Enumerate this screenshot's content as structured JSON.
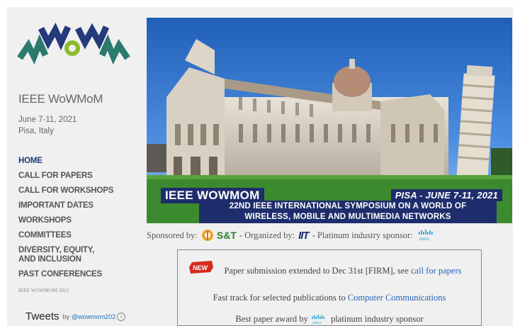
{
  "site": {
    "title": "IEEE WoWMoM",
    "date": "June 7-11, 2021",
    "location": "Pisa, Italy",
    "footer_note": "IEEE WOWMOM 2021"
  },
  "nav": {
    "items": [
      {
        "label": "HOME",
        "active": true
      },
      {
        "label": "CALL FOR PAPERS"
      },
      {
        "label": "CALL FOR WORKSHOPS"
      },
      {
        "label": "IMPORTANT DATES"
      },
      {
        "label": "WORKSHOPS"
      },
      {
        "label": "COMMITTEES"
      },
      {
        "label": "DIVERSITY, EQUITY, AND INCLUSION"
      },
      {
        "label": "PAST CONFERENCES"
      }
    ]
  },
  "tweets": {
    "title": "Tweets",
    "by": "by",
    "handle": "@wowmom202"
  },
  "banner": {
    "title": "IEEE WOWMOM",
    "dates": "PISA - JUNE 7-11, 2021",
    "subtitle_line1": "22ND IEEE INTERNATIONAL SYMPOSIUM ON A WORLD OF",
    "subtitle_line2": "WIRELESS, MOBILE AND MULTIMEDIA NETWORKS"
  },
  "sponsors": {
    "sponsored_by": "Sponsored by:",
    "organized_by": "- Organized by:",
    "platinum": "- Platinum industry sponsor:",
    "st_logo": "S&T",
    "iit_logo": "IIT",
    "cisco_logo": "cisco"
  },
  "news": {
    "badge": "NEW",
    "line1_text": "Paper submission extended to Dec 31st [FIRM], see",
    "line1_link": "call for papers",
    "line2_text": "Fast track for selected publications to",
    "line2_link": "Computer Communications",
    "line3_before": "Best paper award by",
    "line3_after": "platinum industry sponsor"
  },
  "colors": {
    "nav_active": "#1e3a73",
    "banner_label_bg": "#1e2d6b",
    "link": "#2462b8",
    "logo_teal": "#2a7a6e",
    "logo_navy": "#243a7a",
    "logo_green": "#8bbb2e"
  }
}
